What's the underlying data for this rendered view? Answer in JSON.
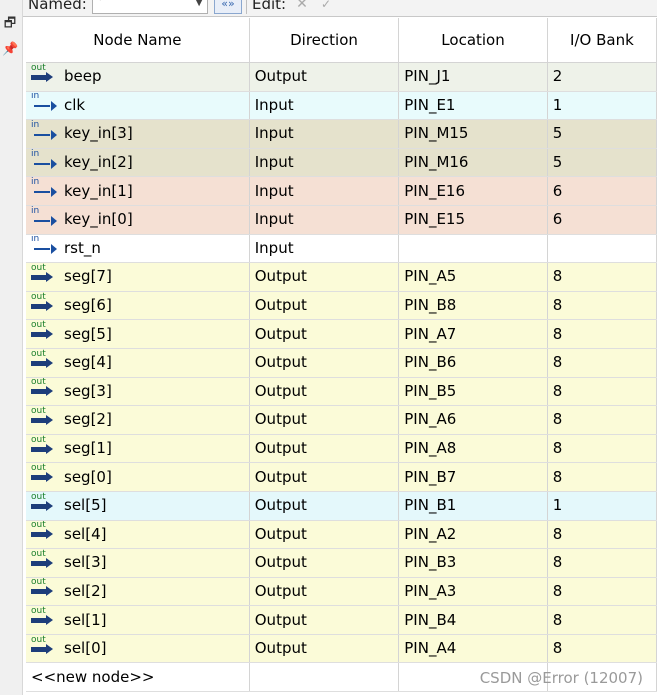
{
  "toolbar": {
    "named_label": "Named:",
    "named_value": "*",
    "filter_button": "«»",
    "edit_label": "Edit:",
    "cancel_glyph": "✕",
    "accept_glyph": "✓"
  },
  "side_icons": [
    "restore-icon",
    "pin-icon"
  ],
  "columns": [
    "Node Name",
    "Direction",
    "Location",
    "I/O Bank"
  ],
  "colors": {
    "output_green": "#eef2e9",
    "input_blue": "#e8fbfc",
    "bank5_olive": "#e5e2cc",
    "bank6_peach": "#f5e0d4",
    "plain_white": "#ffffff",
    "output_yellow": "#fbfbd8",
    "bank1_cyan": "#e4f8fb"
  },
  "rows": [
    {
      "dir": "out",
      "name": "beep",
      "direction": "Output",
      "location": "PIN_J1",
      "bank": "2",
      "bg": "#eef2e9"
    },
    {
      "dir": "in",
      "name": "clk",
      "direction": "Input",
      "location": "PIN_E1",
      "bank": "1",
      "bg": "#e8fbfc"
    },
    {
      "dir": "in",
      "name": "key_in[3]",
      "direction": "Input",
      "location": "PIN_M15",
      "bank": "5",
      "bg": "#e5e2cc"
    },
    {
      "dir": "in",
      "name": "key_in[2]",
      "direction": "Input",
      "location": "PIN_M16",
      "bank": "5",
      "bg": "#e5e2cc"
    },
    {
      "dir": "in",
      "name": "key_in[1]",
      "direction": "Input",
      "location": "PIN_E16",
      "bank": "6",
      "bg": "#f5e0d4"
    },
    {
      "dir": "in",
      "name": "key_in[0]",
      "direction": "Input",
      "location": "PIN_E15",
      "bank": "6",
      "bg": "#f5e0d4"
    },
    {
      "dir": "in",
      "name": "rst_n",
      "direction": "Input",
      "location": "",
      "bank": "",
      "bg": "#ffffff"
    },
    {
      "dir": "out",
      "name": "seg[7]",
      "direction": "Output",
      "location": "PIN_A5",
      "bank": "8",
      "bg": "#fbfbd8"
    },
    {
      "dir": "out",
      "name": "seg[6]",
      "direction": "Output",
      "location": "PIN_B8",
      "bank": "8",
      "bg": "#fbfbd8"
    },
    {
      "dir": "out",
      "name": "seg[5]",
      "direction": "Output",
      "location": "PIN_A7",
      "bank": "8",
      "bg": "#fbfbd8"
    },
    {
      "dir": "out",
      "name": "seg[4]",
      "direction": "Output",
      "location": "PIN_B6",
      "bank": "8",
      "bg": "#fbfbd8"
    },
    {
      "dir": "out",
      "name": "seg[3]",
      "direction": "Output",
      "location": "PIN_B5",
      "bank": "8",
      "bg": "#fbfbd8"
    },
    {
      "dir": "out",
      "name": "seg[2]",
      "direction": "Output",
      "location": "PIN_A6",
      "bank": "8",
      "bg": "#fbfbd8"
    },
    {
      "dir": "out",
      "name": "seg[1]",
      "direction": "Output",
      "location": "PIN_A8",
      "bank": "8",
      "bg": "#fbfbd8"
    },
    {
      "dir": "out",
      "name": "seg[0]",
      "direction": "Output",
      "location": "PIN_B7",
      "bank": "8",
      "bg": "#fbfbd8"
    },
    {
      "dir": "out",
      "name": "sel[5]",
      "direction": "Output",
      "location": "PIN_B1",
      "bank": "1",
      "bg": "#e4f8fb"
    },
    {
      "dir": "out",
      "name": "sel[4]",
      "direction": "Output",
      "location": "PIN_A2",
      "bank": "8",
      "bg": "#fbfbd8"
    },
    {
      "dir": "out",
      "name": "sel[3]",
      "direction": "Output",
      "location": "PIN_B3",
      "bank": "8",
      "bg": "#fbfbd8"
    },
    {
      "dir": "out",
      "name": "sel[2]",
      "direction": "Output",
      "location": "PIN_A3",
      "bank": "8",
      "bg": "#fbfbd8"
    },
    {
      "dir": "out",
      "name": "sel[1]",
      "direction": "Output",
      "location": "PIN_B4",
      "bank": "8",
      "bg": "#fbfbd8"
    },
    {
      "dir": "out",
      "name": "sel[0]",
      "direction": "Output",
      "location": "PIN_A4",
      "bank": "8",
      "bg": "#fbfbd8"
    }
  ],
  "new_node_label": "<<new node>>",
  "watermark": "CSDN @Error (12007)"
}
